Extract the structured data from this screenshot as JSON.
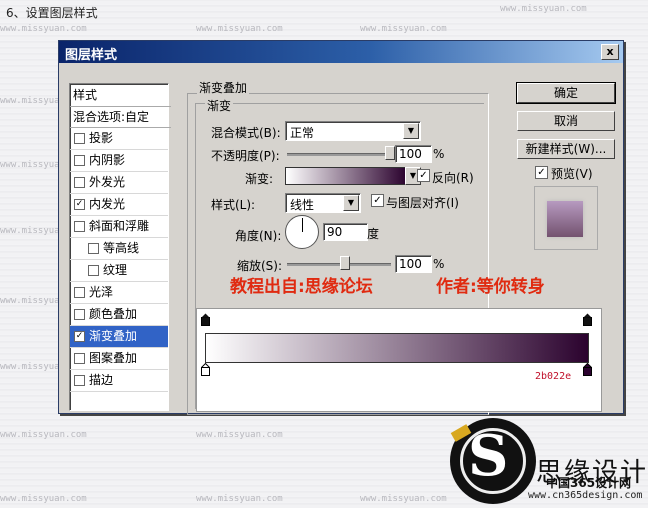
{
  "step_caption": "6、设置图层样式",
  "watermark": "www.missyuan.com",
  "dialog": {
    "title": "图层样式",
    "close_label": "x",
    "style_list": {
      "header": "样式",
      "blend_options": "混合选项:自定",
      "items": [
        {
          "label": "投影",
          "checked": false,
          "indent": false,
          "selected": false
        },
        {
          "label": "内阴影",
          "checked": false,
          "indent": false,
          "selected": false
        },
        {
          "label": "外发光",
          "checked": false,
          "indent": false,
          "selected": false
        },
        {
          "label": "内发光",
          "checked": true,
          "indent": false,
          "selected": false
        },
        {
          "label": "斜面和浮雕",
          "checked": false,
          "indent": false,
          "selected": false
        },
        {
          "label": "等高线",
          "checked": false,
          "indent": true,
          "selected": false
        },
        {
          "label": "纹理",
          "checked": false,
          "indent": true,
          "selected": false
        },
        {
          "label": "光泽",
          "checked": false,
          "indent": false,
          "selected": false
        },
        {
          "label": "颜色叠加",
          "checked": false,
          "indent": false,
          "selected": false
        },
        {
          "label": "渐变叠加",
          "checked": true,
          "indent": false,
          "selected": true
        },
        {
          "label": "图案叠加",
          "checked": false,
          "indent": false,
          "selected": false
        },
        {
          "label": "描边",
          "checked": false,
          "indent": false,
          "selected": false
        }
      ]
    },
    "panel": {
      "group_title": "渐变叠加",
      "subgroup_title": "渐变",
      "blend_mode_label": "混合模式(B):",
      "blend_mode_value": "正常",
      "opacity_label": "不透明度(P):",
      "opacity_value": "100",
      "percent": "%",
      "gradient_label": "渐变:",
      "reverse_label": "反向(R)",
      "reverse_checked": true,
      "style_label": "样式(L):",
      "style_value": "线性",
      "align_label": "与图层对齐(I)",
      "align_checked": true,
      "angle_label": "角度(N):",
      "angle_value": "90",
      "angle_unit": "度",
      "scale_label": "缩放(S):",
      "scale_value": "100",
      "opacity_fraction": 1.0,
      "scale_fraction": 0.55
    },
    "buttons": {
      "ok": "确定",
      "cancel": "取消",
      "new_style": "新建样式(W)...",
      "preview_label": "预览(V)",
      "preview_checked": true
    }
  },
  "credit_left": "教程出自:思缘论坛",
  "credit_right": "作者:等你转身",
  "gradient": {
    "start_color": "#ffffff",
    "end_color": "#2b022e",
    "end_hex_label": "2b022e"
  },
  "logo": {
    "calligraphy": "思缘设计",
    "site": "中国365设计网",
    "site_url": "www.cn365design.com"
  },
  "colors": {
    "accent_select": "#3163c6",
    "title_bar": "#0a246a",
    "credit_red": "#e02a10"
  }
}
